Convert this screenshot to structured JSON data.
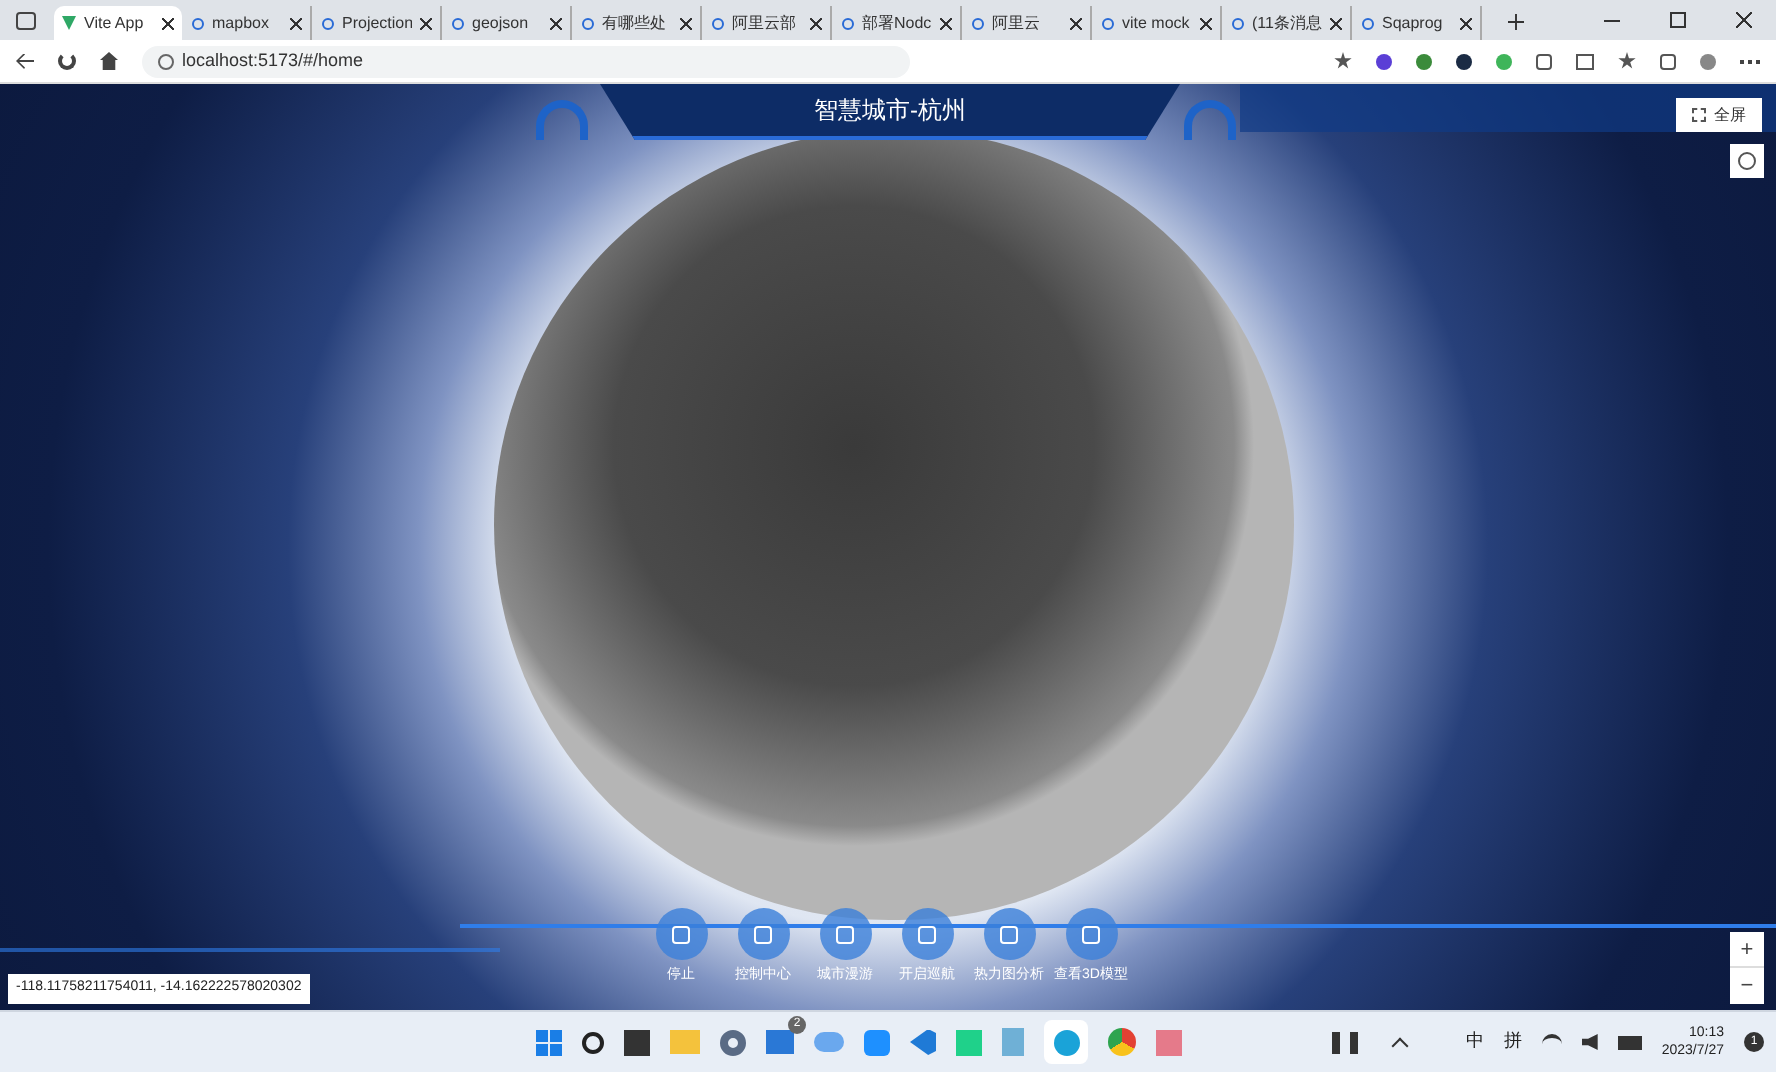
{
  "browser": {
    "tabs": [
      {
        "label": "Vite App",
        "selected": true
      },
      {
        "label": "mapbox",
        "selected": false
      },
      {
        "label": "Projection",
        "selected": false
      },
      {
        "label": "geojson",
        "selected": false
      },
      {
        "label": "有哪些处",
        "selected": false
      },
      {
        "label": "阿里云部",
        "selected": false
      },
      {
        "label": "部署Nodc",
        "selected": false
      },
      {
        "label": "阿里云",
        "selected": false
      },
      {
        "label": "vite mock",
        "selected": false
      },
      {
        "label": "(11条消息",
        "selected": false
      },
      {
        "label": "Sqaprog",
        "selected": false
      }
    ],
    "url": "localhost:5173/#/home"
  },
  "page": {
    "title": "智慧城市-杭州",
    "fullscreen_button": "全屏",
    "coordinates": "-118.11758211754011, -14.162222578020302",
    "tools": [
      "停止",
      "控制中心",
      "城市漫游",
      "开启巡航",
      "热力图分析",
      "查看3D模型"
    ],
    "zoom": {
      "in": "+",
      "out": "−"
    }
  },
  "taskbar": {
    "mail_badge": "2",
    "ime_mode": "中",
    "ime_name": "拼",
    "time": "10:13",
    "date": "2023/7/27",
    "notifications": "1"
  }
}
